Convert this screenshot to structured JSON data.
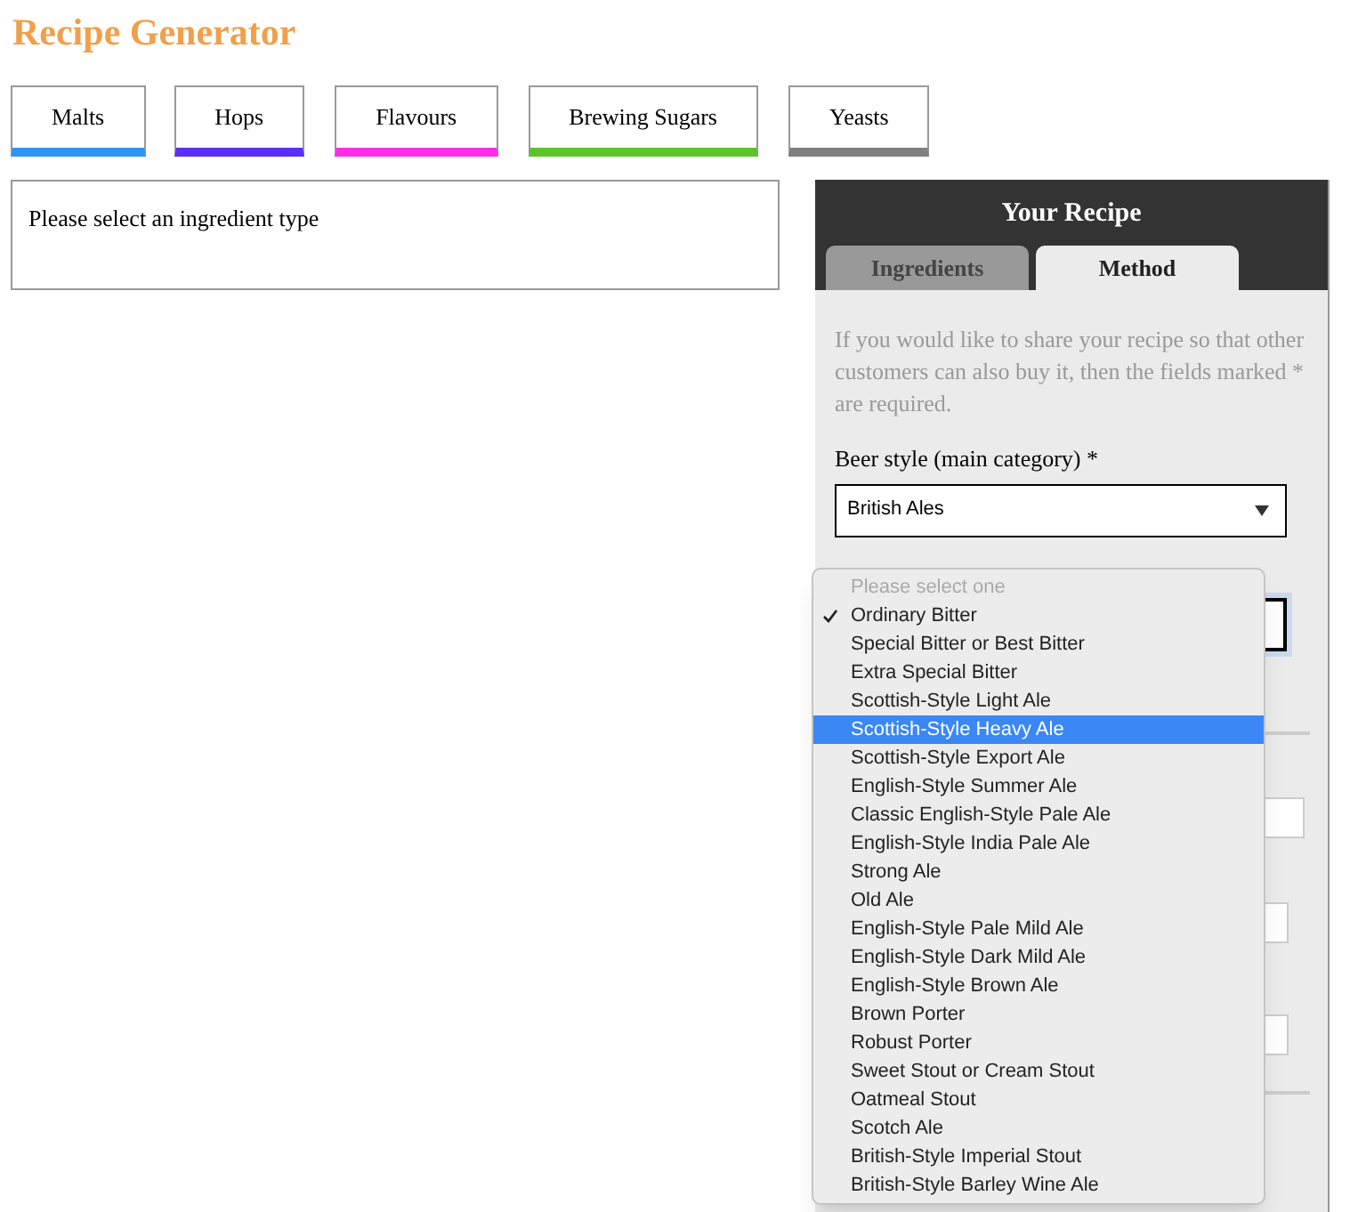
{
  "title": "Recipe Generator",
  "ingredient_tabs": [
    {
      "label": "Malts",
      "color": "#2e95f5"
    },
    {
      "label": "Hops",
      "color": "#5a30f5"
    },
    {
      "label": "Flavours",
      "color": "#ff2ee6"
    },
    {
      "label": "Brewing Sugars",
      "color": "#5cc42a"
    },
    {
      "label": "Yeasts",
      "color": "#808080"
    }
  ],
  "ingredient_panel": {
    "message": "Please select an ingredient type"
  },
  "recipe": {
    "title": "Your Recipe",
    "tabs": [
      {
        "label": "Ingredients",
        "selected": false
      },
      {
        "label": "Method",
        "selected": true
      }
    ],
    "intro": "If you would like to share your recipe so that other customers can also buy it, then the fields marked * are required.",
    "beer_style": {
      "label": "Beer style (main category) *",
      "value": "British Ales"
    },
    "dropdown": {
      "prompt": "Please select one",
      "options": [
        {
          "label": "Ordinary Bitter",
          "checked": true,
          "selected": false
        },
        {
          "label": "Special Bitter or Best Bitter",
          "checked": false,
          "selected": false
        },
        {
          "label": "Extra Special Bitter",
          "checked": false,
          "selected": false
        },
        {
          "label": "Scottish-Style Light Ale",
          "checked": false,
          "selected": false
        },
        {
          "label": "Scottish-Style Heavy Ale",
          "checked": false,
          "selected": true
        },
        {
          "label": "Scottish-Style Export Ale",
          "checked": false,
          "selected": false
        },
        {
          "label": "English-Style Summer Ale",
          "checked": false,
          "selected": false
        },
        {
          "label": "Classic English-Style Pale Ale",
          "checked": false,
          "selected": false
        },
        {
          "label": "English-Style India Pale Ale",
          "checked": false,
          "selected": false
        },
        {
          "label": "Strong Ale",
          "checked": false,
          "selected": false
        },
        {
          "label": "Old Ale",
          "checked": false,
          "selected": false
        },
        {
          "label": "English-Style Pale Mild Ale",
          "checked": false,
          "selected": false
        },
        {
          "label": "English-Style Dark Mild Ale",
          "checked": false,
          "selected": false
        },
        {
          "label": "English-Style Brown Ale",
          "checked": false,
          "selected": false
        },
        {
          "label": "Brown Porter",
          "checked": false,
          "selected": false
        },
        {
          "label": "Robust Porter",
          "checked": false,
          "selected": false
        },
        {
          "label": "Sweet Stout or Cream Stout",
          "checked": false,
          "selected": false
        },
        {
          "label": "Oatmeal Stout",
          "checked": false,
          "selected": false
        },
        {
          "label": "Scotch Ale",
          "checked": false,
          "selected": false
        },
        {
          "label": "British-Style Imperial Stout",
          "checked": false,
          "selected": false
        },
        {
          "label": "British-Style Barley Wine Ale",
          "checked": false,
          "selected": false
        }
      ]
    }
  }
}
